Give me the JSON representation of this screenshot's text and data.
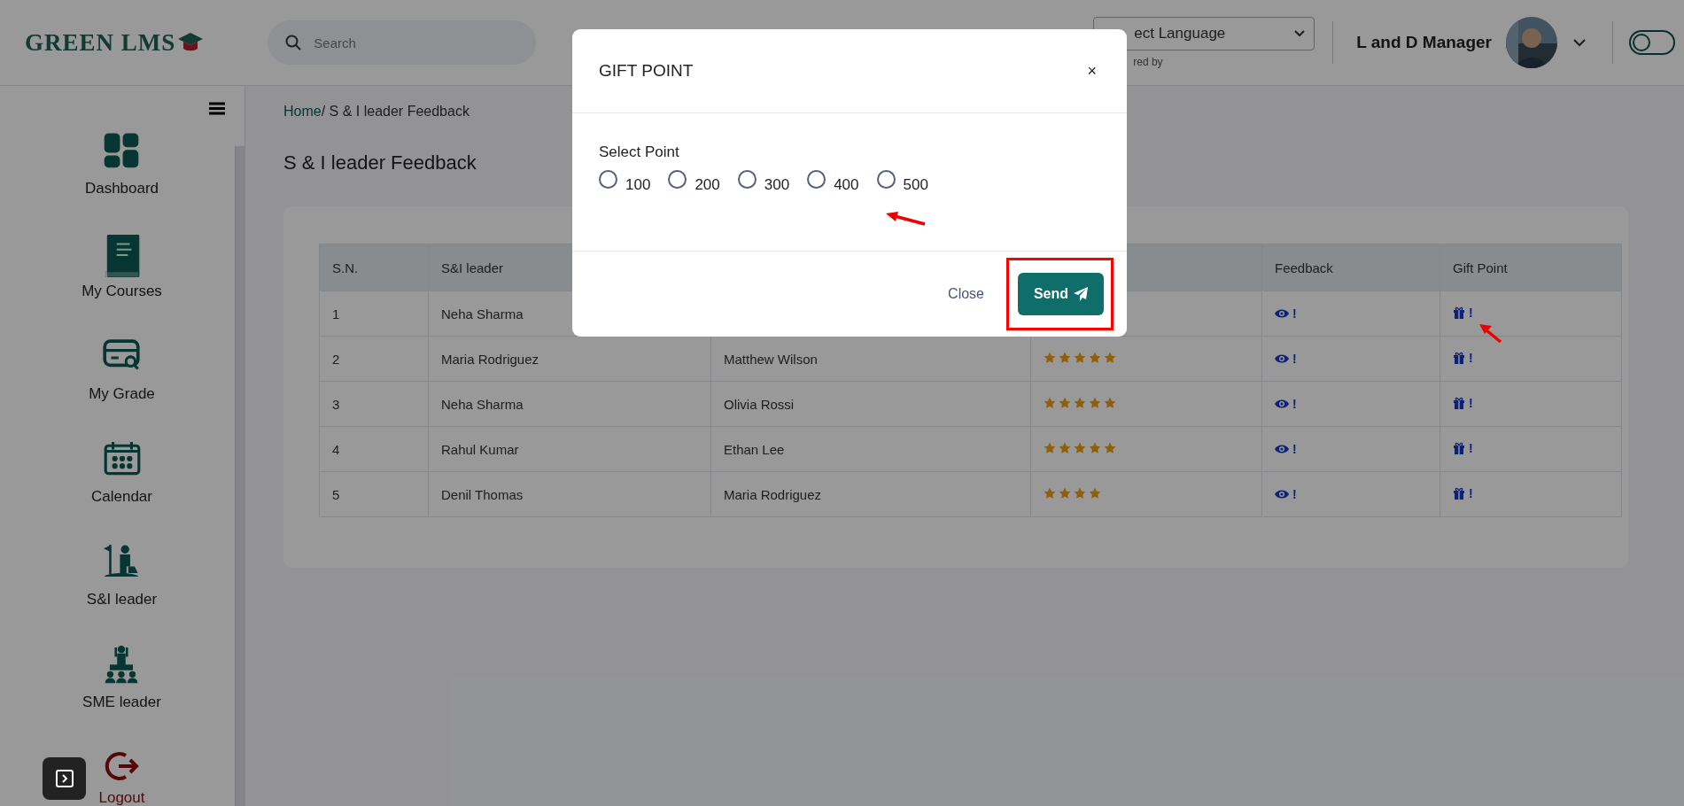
{
  "header": {
    "logo": "GREEN LMS",
    "search": {
      "placeholder": "Search"
    },
    "language": {
      "value": "ect Language",
      "powered": "red by"
    },
    "user": "L and D Manager",
    "theme_toggle": {
      "on": false
    }
  },
  "sidebar": {
    "items": [
      {
        "label": "Dashboard",
        "kind": "link"
      },
      {
        "label": "My Courses",
        "kind": "link"
      },
      {
        "label": "My Grade",
        "kind": "link"
      },
      {
        "label": "Calendar",
        "kind": "link"
      },
      {
        "label": "S&I leader",
        "kind": "link"
      },
      {
        "label": "SME leader",
        "kind": "link"
      },
      {
        "label": "Logout",
        "kind": "logout"
      }
    ]
  },
  "breadcrumb": {
    "home": "Home",
    "current": "/ S & I leader Feedback"
  },
  "page_title": "S & I leader Feedback",
  "table": {
    "columns": [
      "S.N.",
      "S&I leader",
      "Feedback",
      "Gift Point"
    ],
    "rows": [
      {
        "sn": "1",
        "leader": "Neha Sharma",
        "feedback": "!",
        "gift": "!"
      },
      {
        "sn": "2",
        "leader": "Maria Rodriguez",
        "column_3": "Matthew Wilson",
        "stars": 5,
        "feedback": "!",
        "gift": "!"
      },
      {
        "sn": "3",
        "leader": "Neha Sharma",
        "column_3": "Olivia Rossi",
        "stars": 5,
        "feedback": "!",
        "gift": "!"
      },
      {
        "sn": "4",
        "leader": "Rahul Kumar",
        "column_3": "Ethan Lee",
        "stars": 5,
        "feedback": "!",
        "gift": "!"
      },
      {
        "sn": "5",
        "leader": "Denil Thomas",
        "column_3": "Maria Rodriguez",
        "stars": 4,
        "feedback": "!",
        "gift": "!"
      }
    ]
  },
  "modal": {
    "title": "GIFT POINT",
    "close_icon": "×",
    "label": "Select Point",
    "options": [
      {
        "label": "100",
        "selected": false
      },
      {
        "label": "200",
        "selected": false
      },
      {
        "label": "300",
        "selected": false
      },
      {
        "label": "400",
        "selected": false
      },
      {
        "label": "500",
        "selected": false
      }
    ],
    "close_button": "Close",
    "send_button": "Send"
  }
}
